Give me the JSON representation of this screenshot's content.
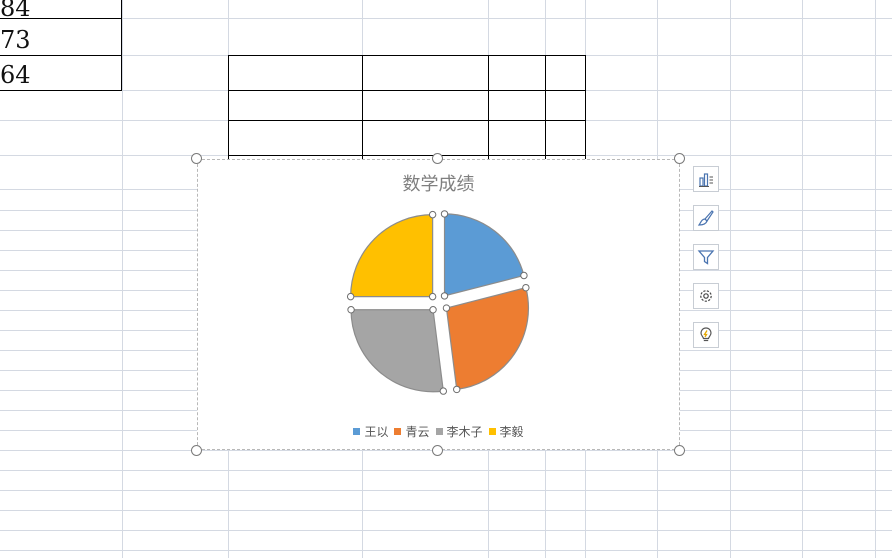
{
  "sheet": {
    "cells": [
      "84",
      "73",
      "64"
    ]
  },
  "chart": {
    "title": "数学成绩",
    "colors": [
      "#5B9BD5",
      "#ED7D31",
      "#A5A5A5",
      "#FFC000"
    ]
  },
  "chart_data": {
    "type": "pie",
    "title": "数学成绩",
    "categories": [
      "王以",
      "青云",
      "李木子",
      "李毅"
    ],
    "values": [
      21,
      27,
      27,
      25
    ],
    "exploded": true,
    "legend": "bottom"
  },
  "toolbar_icons": [
    "chart-elements-icon",
    "chart-style-icon",
    "chart-filter-icon",
    "chart-settings-icon",
    "chart-ideas-icon"
  ]
}
